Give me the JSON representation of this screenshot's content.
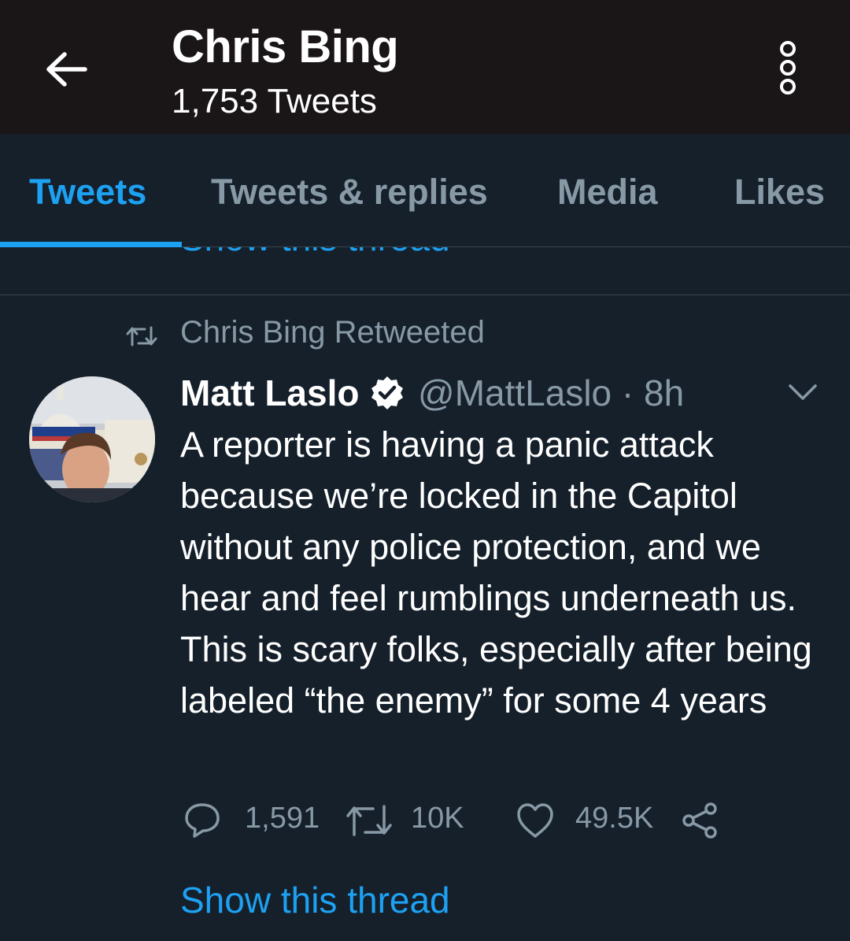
{
  "header": {
    "title": "Chris Bing",
    "subtitle": "1,753 Tweets"
  },
  "tabs": [
    {
      "label": "Tweets",
      "active": true
    },
    {
      "label": "Tweets & replies",
      "active": false
    },
    {
      "label": "Media",
      "active": false
    },
    {
      "label": "Likes",
      "active": false
    }
  ],
  "previous_tweet": {
    "show_thread_label": "Show this thread"
  },
  "tweet": {
    "retweet_context": "Chris Bing Retweeted",
    "author_name": "Matt Laslo",
    "author_handle_time": "@MattLaslo · 8h",
    "text": "A reporter is having a panic attack because we’re locked in the Capitol without any police protection, and we hear and feel rumblings underneath us. This is scary folks, especially after being labeled “the enemy” for some 4 years",
    "reply_count": "1,591",
    "retweet_count": "10K",
    "like_count": "49.5K",
    "show_thread_label": "Show this thread"
  },
  "colors": {
    "background": "#15202b",
    "header_bg": "#1a1516",
    "accent": "#1da1f2",
    "secondary_text": "#8899a6",
    "divider": "#38444d"
  },
  "icons": [
    "back-arrow-icon",
    "more-options-icon",
    "retweet-icon",
    "verified-badge-icon",
    "chevron-down-icon",
    "reply-icon",
    "like-icon",
    "share-icon"
  ]
}
